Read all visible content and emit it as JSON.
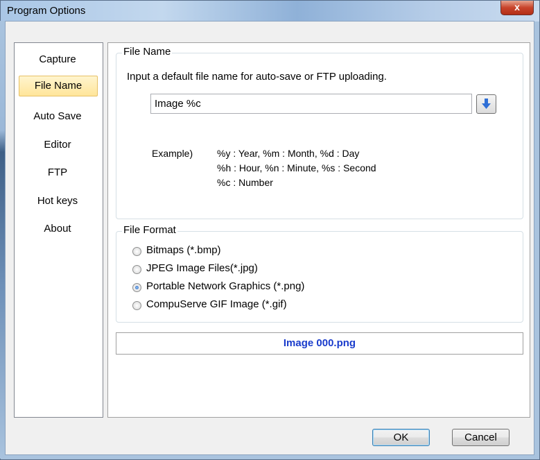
{
  "window": {
    "title": "Program Options",
    "close_label": "x"
  },
  "sidebar": {
    "items": [
      {
        "label": "Capture"
      },
      {
        "label": "File Name"
      },
      {
        "label": "Auto Save"
      },
      {
        "label": "Editor"
      },
      {
        "label": "FTP"
      },
      {
        "label": "Hot keys"
      },
      {
        "label": "About"
      }
    ],
    "selected": "File Name"
  },
  "file_name": {
    "group_title": "File Name",
    "instruction": "Input a default file name for auto-save or FTP uploading.",
    "input_value": "Image %c",
    "example_label": "Example)",
    "example_lines": [
      "%y : Year, %m : Month, %d : Day",
      "%h : Hour, %n : Minute, %s : Second",
      "%c : Number"
    ]
  },
  "file_format": {
    "group_title": "File Format",
    "options": [
      {
        "label": "Bitmaps (*.bmp)",
        "checked": false
      },
      {
        "label": "JPEG Image Files(*.jpg)",
        "checked": false
      },
      {
        "label": "Portable Network Graphics (*.png)",
        "checked": true
      },
      {
        "label": "CompuServe GIF Image (*.gif)",
        "checked": false
      }
    ]
  },
  "preview": {
    "filename": "Image 000.png",
    "color": "#1a3ccc"
  },
  "buttons": {
    "ok": "OK",
    "cancel": "Cancel"
  }
}
